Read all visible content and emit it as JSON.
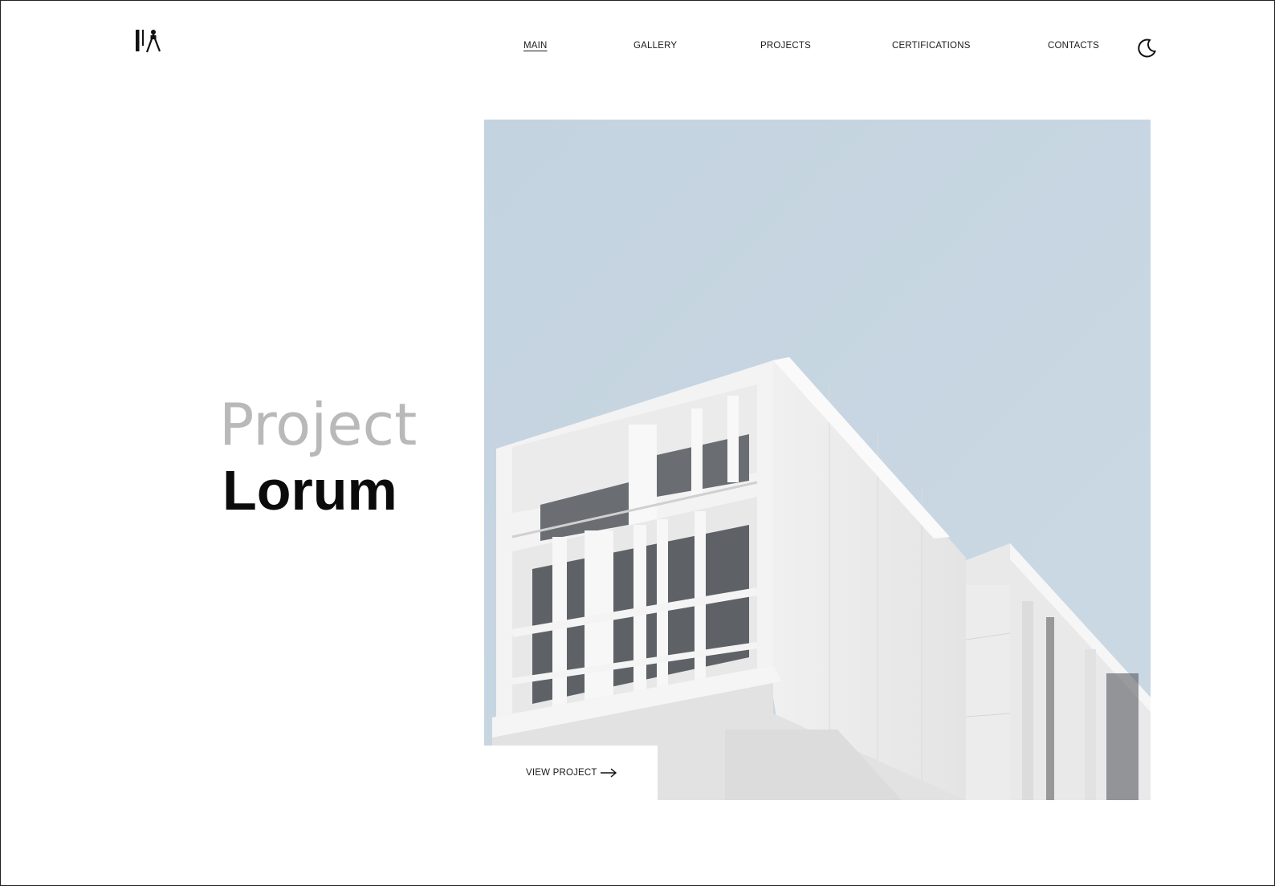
{
  "header": {
    "nav": [
      {
        "label": "MAIN",
        "active": true
      },
      {
        "label": "GALLERY",
        "active": false
      },
      {
        "label": "PROJECTS",
        "active": false
      },
      {
        "label": "CERTIFICATIONS",
        "active": false
      },
      {
        "label": "CONTACTS",
        "active": false
      }
    ],
    "logo_icon": "architect-logo-icon",
    "theme_toggle_icon": "moon-icon"
  },
  "hero": {
    "title_light": "Project",
    "title_bold": "Lorum",
    "image_icon": "building-photo",
    "cta_label": "VIEW PROJECT",
    "cta_icon": "arrow-right-icon"
  },
  "colors": {
    "sky": "#c6d5e1",
    "title_light": "#b9b9b9",
    "title_bold": "#0b0b0b",
    "text": "#1b1b1b"
  }
}
